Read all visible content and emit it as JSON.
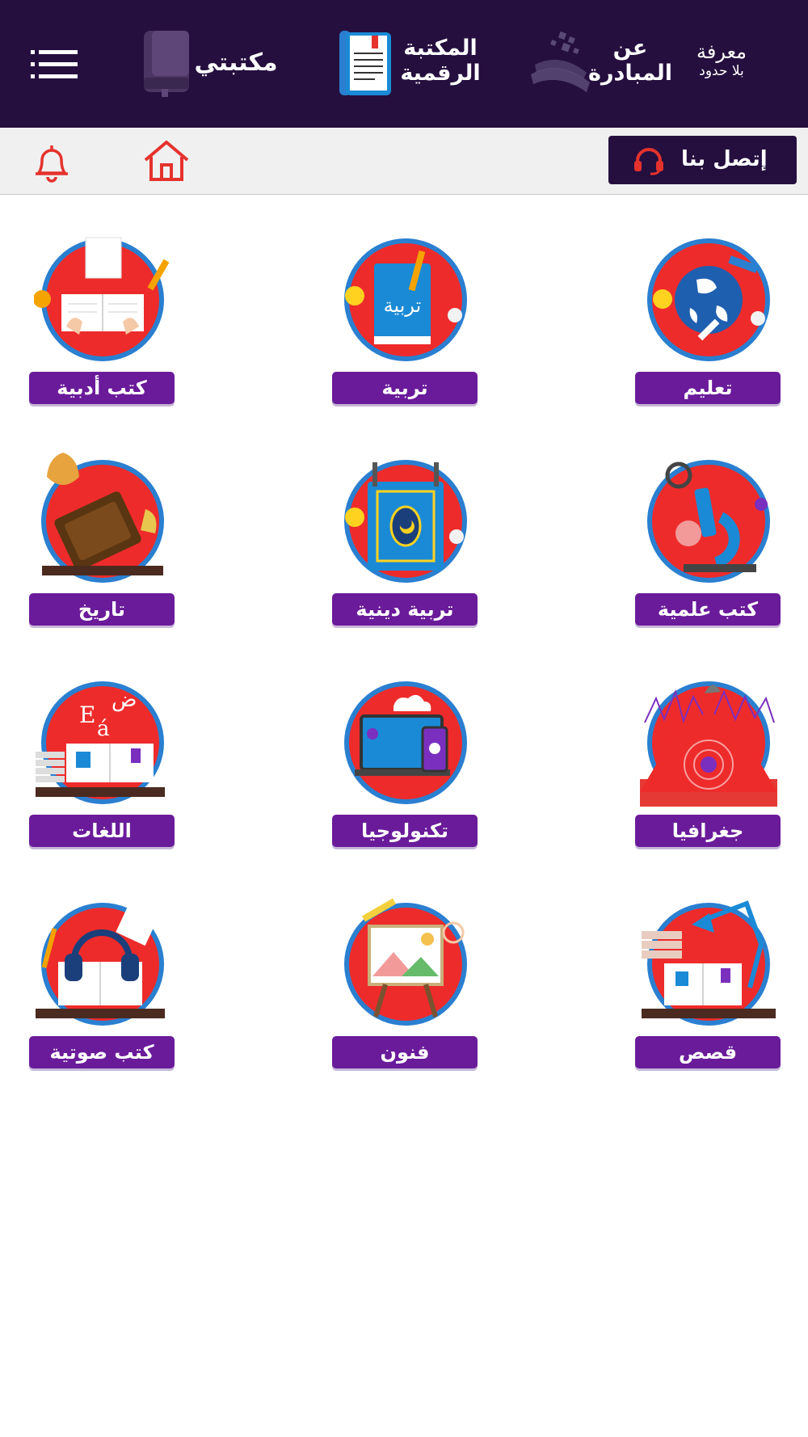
{
  "header": {
    "brand_line1": "معرفة",
    "brand_line2": "بلا حدود",
    "about_line1": "عن",
    "about_line2": "المبادرة",
    "digital_line1": "المكتبة",
    "digital_line2": "الرقمية",
    "mylibrary": "مكتبتي"
  },
  "toolbar": {
    "contact_label": "إتصل بنا"
  },
  "categories": [
    {
      "label": "تعليم",
      "icon": "globe-telescope-icon"
    },
    {
      "label": "تربية",
      "icon": "education-book-icon"
    },
    {
      "label": "كتب أدبية",
      "icon": "literature-writing-icon"
    },
    {
      "label": "كتب علمية",
      "icon": "microscope-icon"
    },
    {
      "label": "تربية دينية",
      "icon": "quran-icon"
    },
    {
      "label": "تاريخ",
      "icon": "old-book-icon"
    },
    {
      "label": "جغرافيا",
      "icon": "volcano-icon"
    },
    {
      "label": "تكنولوجيا",
      "icon": "laptop-phone-icon"
    },
    {
      "label": "اللغات",
      "icon": "languages-book-icon"
    },
    {
      "label": "قصص",
      "icon": "stories-lamp-icon"
    },
    {
      "label": "فنون",
      "icon": "painting-easel-icon"
    },
    {
      "label": "كتب صوتية",
      "icon": "headphones-book-icon"
    }
  ],
  "colors": {
    "header_bg": "#250f3f",
    "label_bg": "#6a1b9a",
    "circle_fill": "#ee2b2b",
    "circle_ring": "#2a7fd0",
    "accent_red": "#e5322d"
  }
}
